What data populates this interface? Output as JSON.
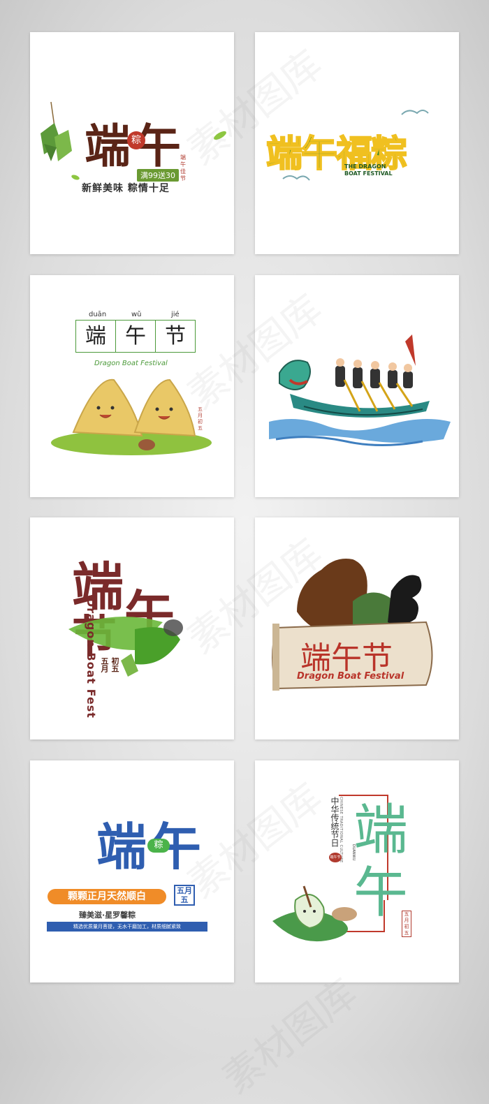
{
  "cards": {
    "c1": {
      "title": "端午",
      "badge": "粽",
      "promo": "满99送30",
      "subtitle": "新鲜美味 粽情十足",
      "seal": "端午佳节"
    },
    "c2": {
      "title": "端午福粽",
      "en_line1": "THE DRAGON",
      "en_line2": "BOAT FESTIVAL"
    },
    "c3": {
      "pinyin": [
        "duān",
        "wǔ",
        "jié"
      ],
      "chars": [
        "端",
        "午",
        "节"
      ],
      "english": "Dragon Boat Festival",
      "seal": "五月初五"
    },
    "c5": {
      "title_top": "端",
      "title_bottom": "节",
      "title_right": "午",
      "vertical_en": "Dragon Boat Fest",
      "date1": "五月",
      "date2": "初五"
    },
    "c6": {
      "title": "端午节",
      "english": "Dragon Boat Festival"
    },
    "c7": {
      "title": "端午",
      "badge": "粽",
      "banner": "颗颗正月天然顺白",
      "date1": "五月",
      "date2": "五",
      "brand": "臻美滋·星罗馨粽",
      "fine": "精选优质量月菩提，无水干磨加工，材质细腻紧致"
    },
    "c8": {
      "vertical_cn": "中华传统节日",
      "vertical_en": "CHINESE TRADITIONAL CULTURE",
      "mini_en": "DUANWU",
      "title": "端午",
      "seal": "五月初五",
      "small_seal": "端午节"
    }
  },
  "watermark": "素材图库"
}
